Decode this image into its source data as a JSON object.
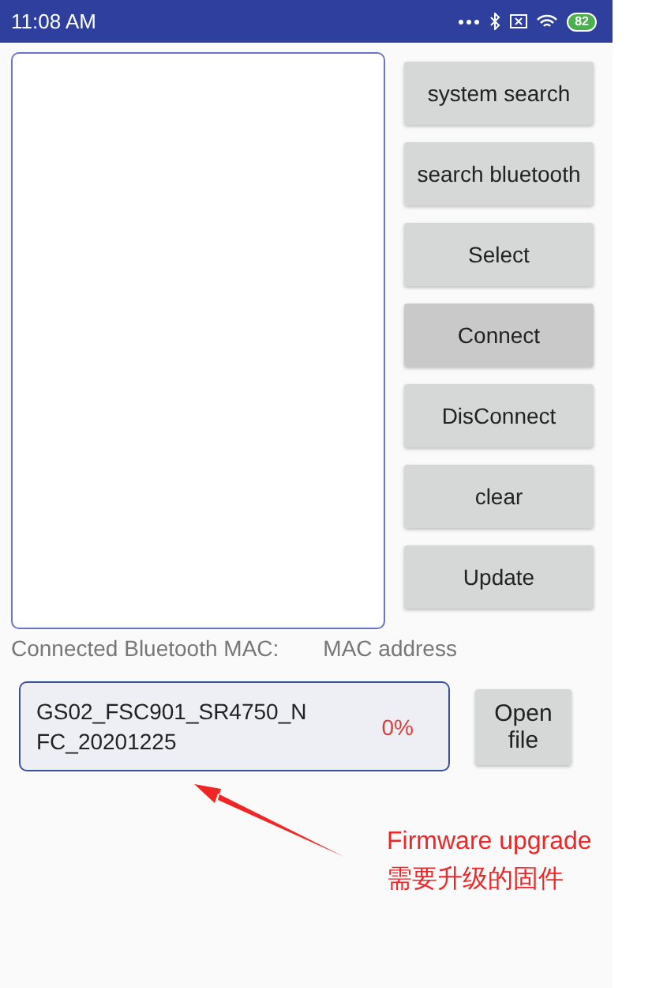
{
  "status_bar": {
    "time": "11:08 AM",
    "battery": "82"
  },
  "buttons": [
    {
      "label": "system search",
      "pressed": false
    },
    {
      "label": "search bluetooth",
      "pressed": false
    },
    {
      "label": "Select",
      "pressed": false
    },
    {
      "label": "Connect",
      "pressed": true
    },
    {
      "label": "DisConnect",
      "pressed": false
    },
    {
      "label": "clear",
      "pressed": false
    },
    {
      "label": "Update",
      "pressed": false
    }
  ],
  "mac_row": {
    "label": "Connected Bluetooth MAC:",
    "value": "MAC address"
  },
  "firmware": {
    "file_name": "GS02_FSC901_SR4750_NFC_20201225",
    "progress": "0%",
    "open_button": "Open file"
  },
  "annotation": {
    "lines": [
      "Firmware upgrade",
      "需要升级的固件"
    ]
  }
}
